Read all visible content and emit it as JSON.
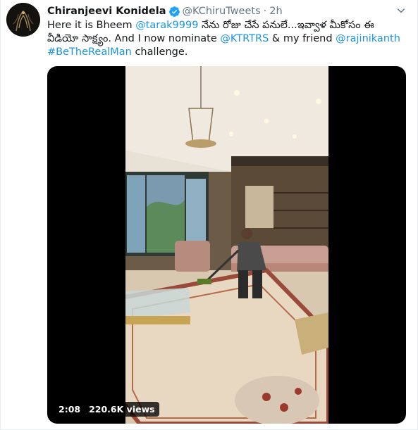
{
  "tweet": {
    "author_name": "Chiranjeevi Konidela",
    "handle": "@KChiruTweets",
    "separator": "·",
    "time": "2h",
    "text_lines": [
      [
        {
          "t": "Here it is Bheem ",
          "link": false
        },
        {
          "t": "@tarak9999",
          "link": true
        },
        {
          "t": "  నేను రోజు చేసే పనులే...ఇవ్వాళ మీకోసం ఈ",
          "link": false
        }
      ],
      [
        {
          "t": "వీడియో సాక్ష్యం. And I now nominate ",
          "link": false
        },
        {
          "t": "@KTRTRS",
          "link": true
        },
        {
          "t": "  & my friend ",
          "link": false
        },
        {
          "t": "@rajinikanth",
          "link": true
        }
      ],
      [
        {
          "t": "#BeTheRealMan",
          "link": true
        },
        {
          "t": " challenge.",
          "link": false
        }
      ]
    ],
    "video": {
      "duration": "2:08",
      "views": "220.6K views"
    }
  },
  "colors": {
    "link": "#1b95e0",
    "verified": "#1da1f2",
    "secondary_text": "#657786"
  },
  "icons": {
    "verified": "verified-badge-icon",
    "caret": "chevron-down-icon"
  }
}
